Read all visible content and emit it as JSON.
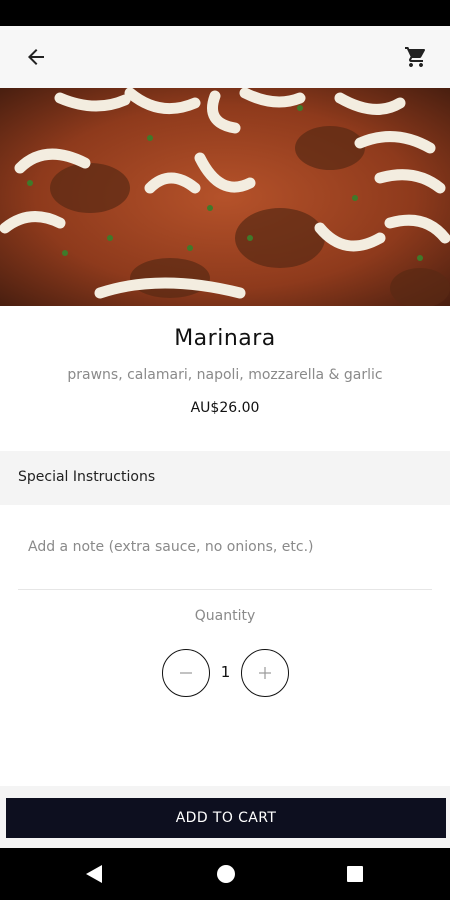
{
  "app_bar": {
    "back_icon": "arrow-back-icon",
    "cart_icon": "shopping-cart-icon"
  },
  "hero": {
    "image": "pizza-marinara-photo"
  },
  "product": {
    "name": "Marinara",
    "description": "prawns, calamari, napoli, mozzarella & garlic",
    "price": "AU$26.00"
  },
  "special_instructions": {
    "heading": "Special Instructions",
    "placeholder": "Add a note (extra sauce, no onions, etc.)",
    "value": ""
  },
  "quantity": {
    "label": "Quantity",
    "value": "1",
    "minus_icon": "minus-icon",
    "plus_icon": "plus-icon"
  },
  "actions": {
    "add_to_cart": "ADD TO CART"
  },
  "colors": {
    "primary_button": "#0d0f1f",
    "secondary_text": "#8a8a8a",
    "section_background": "#f4f4f4"
  }
}
